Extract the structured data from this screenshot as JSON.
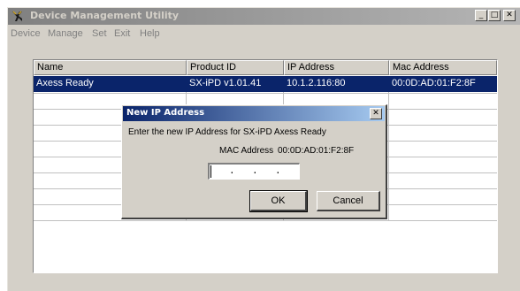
{
  "window": {
    "title": "Device Management Utility",
    "minimize_glyph": "_",
    "maximize_glyph": "□",
    "close_glyph": "✕"
  },
  "menu": [
    {
      "label": "Device"
    },
    {
      "label": "Manage"
    },
    {
      "label": "Set"
    },
    {
      "label": "Exit"
    },
    {
      "label": "Help"
    }
  ],
  "table": {
    "columns": [
      "Name",
      "Product ID",
      "IP Address",
      "Mac Address"
    ],
    "rows": [
      {
        "name": "Axess Ready",
        "product_id": "SX-iPD v1.01.41",
        "ip": "10.1.2.116:80",
        "mac": "00:0D:AD:01:F2:8F",
        "selected": true
      }
    ]
  },
  "dialog": {
    "title": "New IP Address",
    "close_glyph": "✕",
    "prompt": "Enter the new IP Address for SX-iPD  Axess Ready",
    "mac_label": "MAC Address",
    "mac_value": "00:0D:AD:01:F2:8F",
    "ip_value": "",
    "ip_separator": ".",
    "ok_label": "OK",
    "cancel_label": "Cancel"
  },
  "colors": {
    "selection": "#0a246a",
    "dialog_title_start": "#0a246a",
    "dialog_title_end": "#a6caf0",
    "inactive_title_start": "#808080",
    "face": "#d4d0c8"
  },
  "icons": {
    "app": "device-utility-icon",
    "window_close": "close-icon",
    "dialog_close": "close-icon"
  }
}
